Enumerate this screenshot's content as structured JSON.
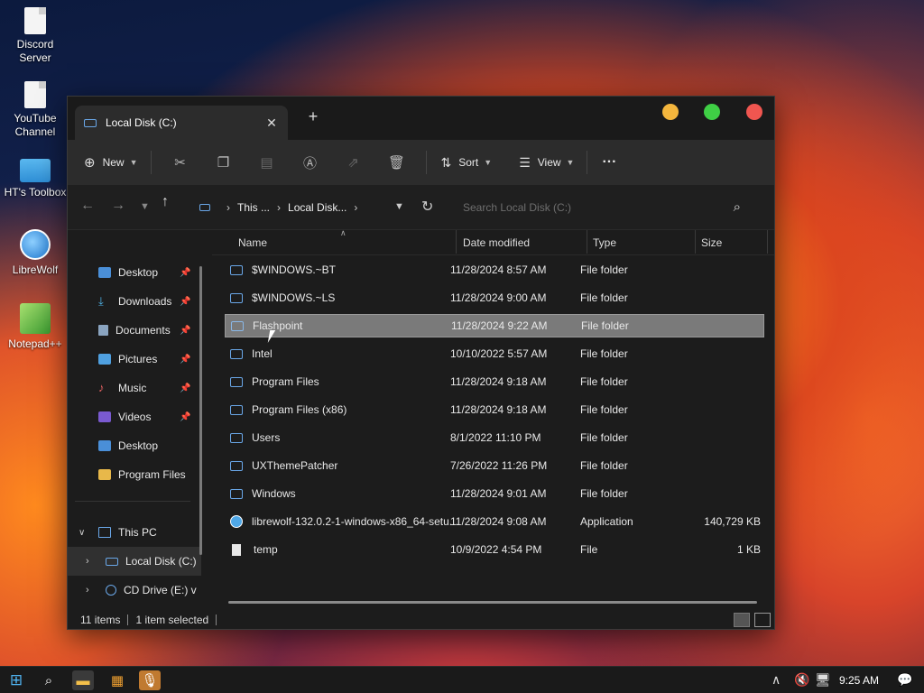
{
  "desktop": {
    "icons": [
      {
        "label": "Discord Server"
      },
      {
        "label": "YouTube Channel"
      },
      {
        "label": "HT's Toolbox"
      },
      {
        "label": "LibreWolf"
      },
      {
        "label": "Notepad++"
      }
    ]
  },
  "window": {
    "tab_title": "Local Disk (C:)",
    "tab_close": "✕",
    "new_tab": "+",
    "toolbar": {
      "new_label": "New",
      "sort_label": "Sort",
      "view_label": "View",
      "more_label": "···"
    },
    "address": {
      "crumbs": [
        "This ...",
        "Local Disk..."
      ],
      "search_placeholder": "Search Local Disk (C:)"
    },
    "nav_pane": {
      "quick_access": [
        {
          "label": "Desktop",
          "pinned": true
        },
        {
          "label": "Downloads",
          "pinned": true
        },
        {
          "label": "Documents",
          "pinned": true
        },
        {
          "label": "Pictures",
          "pinned": true
        },
        {
          "label": "Music",
          "pinned": true
        },
        {
          "label": "Videos",
          "pinned": true
        },
        {
          "label": "Desktop",
          "pinned": false
        },
        {
          "label": "Program Files",
          "pinned": false
        }
      ],
      "this_pc": "This PC",
      "drives": [
        {
          "label": "Local Disk (C:)",
          "selected": true
        },
        {
          "label": "CD Drive (E:) v",
          "selected": false
        }
      ]
    },
    "columns": {
      "name": "Name",
      "date": "Date modified",
      "type": "Type",
      "size": "Size"
    },
    "files": [
      {
        "name": "$WINDOWS.~BT",
        "date": "11/28/2024 8:57 AM",
        "type": "File folder",
        "size": "",
        "kind": "folder"
      },
      {
        "name": "$WINDOWS.~LS",
        "date": "11/28/2024 9:00 AM",
        "type": "File folder",
        "size": "",
        "kind": "folder"
      },
      {
        "name": "Flashpoint",
        "date": "11/28/2024 9:22 AM",
        "type": "File folder",
        "size": "",
        "kind": "folder",
        "selected": true
      },
      {
        "name": "Intel",
        "date": "10/10/2022 5:57 AM",
        "type": "File folder",
        "size": "",
        "kind": "folder"
      },
      {
        "name": "Program Files",
        "date": "11/28/2024 9:18 AM",
        "type": "File folder",
        "size": "",
        "kind": "folder"
      },
      {
        "name": "Program Files (x86)",
        "date": "11/28/2024 9:18 AM",
        "type": "File folder",
        "size": "",
        "kind": "folder"
      },
      {
        "name": "Users",
        "date": "8/1/2022 11:10 PM",
        "type": "File folder",
        "size": "",
        "kind": "folder"
      },
      {
        "name": "UXThemePatcher",
        "date": "7/26/2022 11:26 PM",
        "type": "File folder",
        "size": "",
        "kind": "folder"
      },
      {
        "name": "Windows",
        "date": "11/28/2024 9:01 AM",
        "type": "File folder",
        "size": "",
        "kind": "folder"
      },
      {
        "name": "librewolf-132.0.2-1-windows-x86_64-setu...",
        "date": "11/28/2024 9:08 AM",
        "type": "Application",
        "size": "140,729 KB",
        "kind": "app"
      },
      {
        "name": "temp",
        "date": "10/9/2022 4:54 PM",
        "type": "File",
        "size": "1 KB",
        "kind": "file"
      }
    ],
    "status": {
      "items": "11 items",
      "selected": "1 item selected"
    }
  },
  "taskbar": {
    "clock": "9:25 AM"
  },
  "colors": {
    "folder_accent": "#6aa7e8",
    "close_dot": "#f05650",
    "max_dot": "#3fcf45",
    "min_dot": "#f4b63d",
    "selection": "#7a7a7a"
  }
}
